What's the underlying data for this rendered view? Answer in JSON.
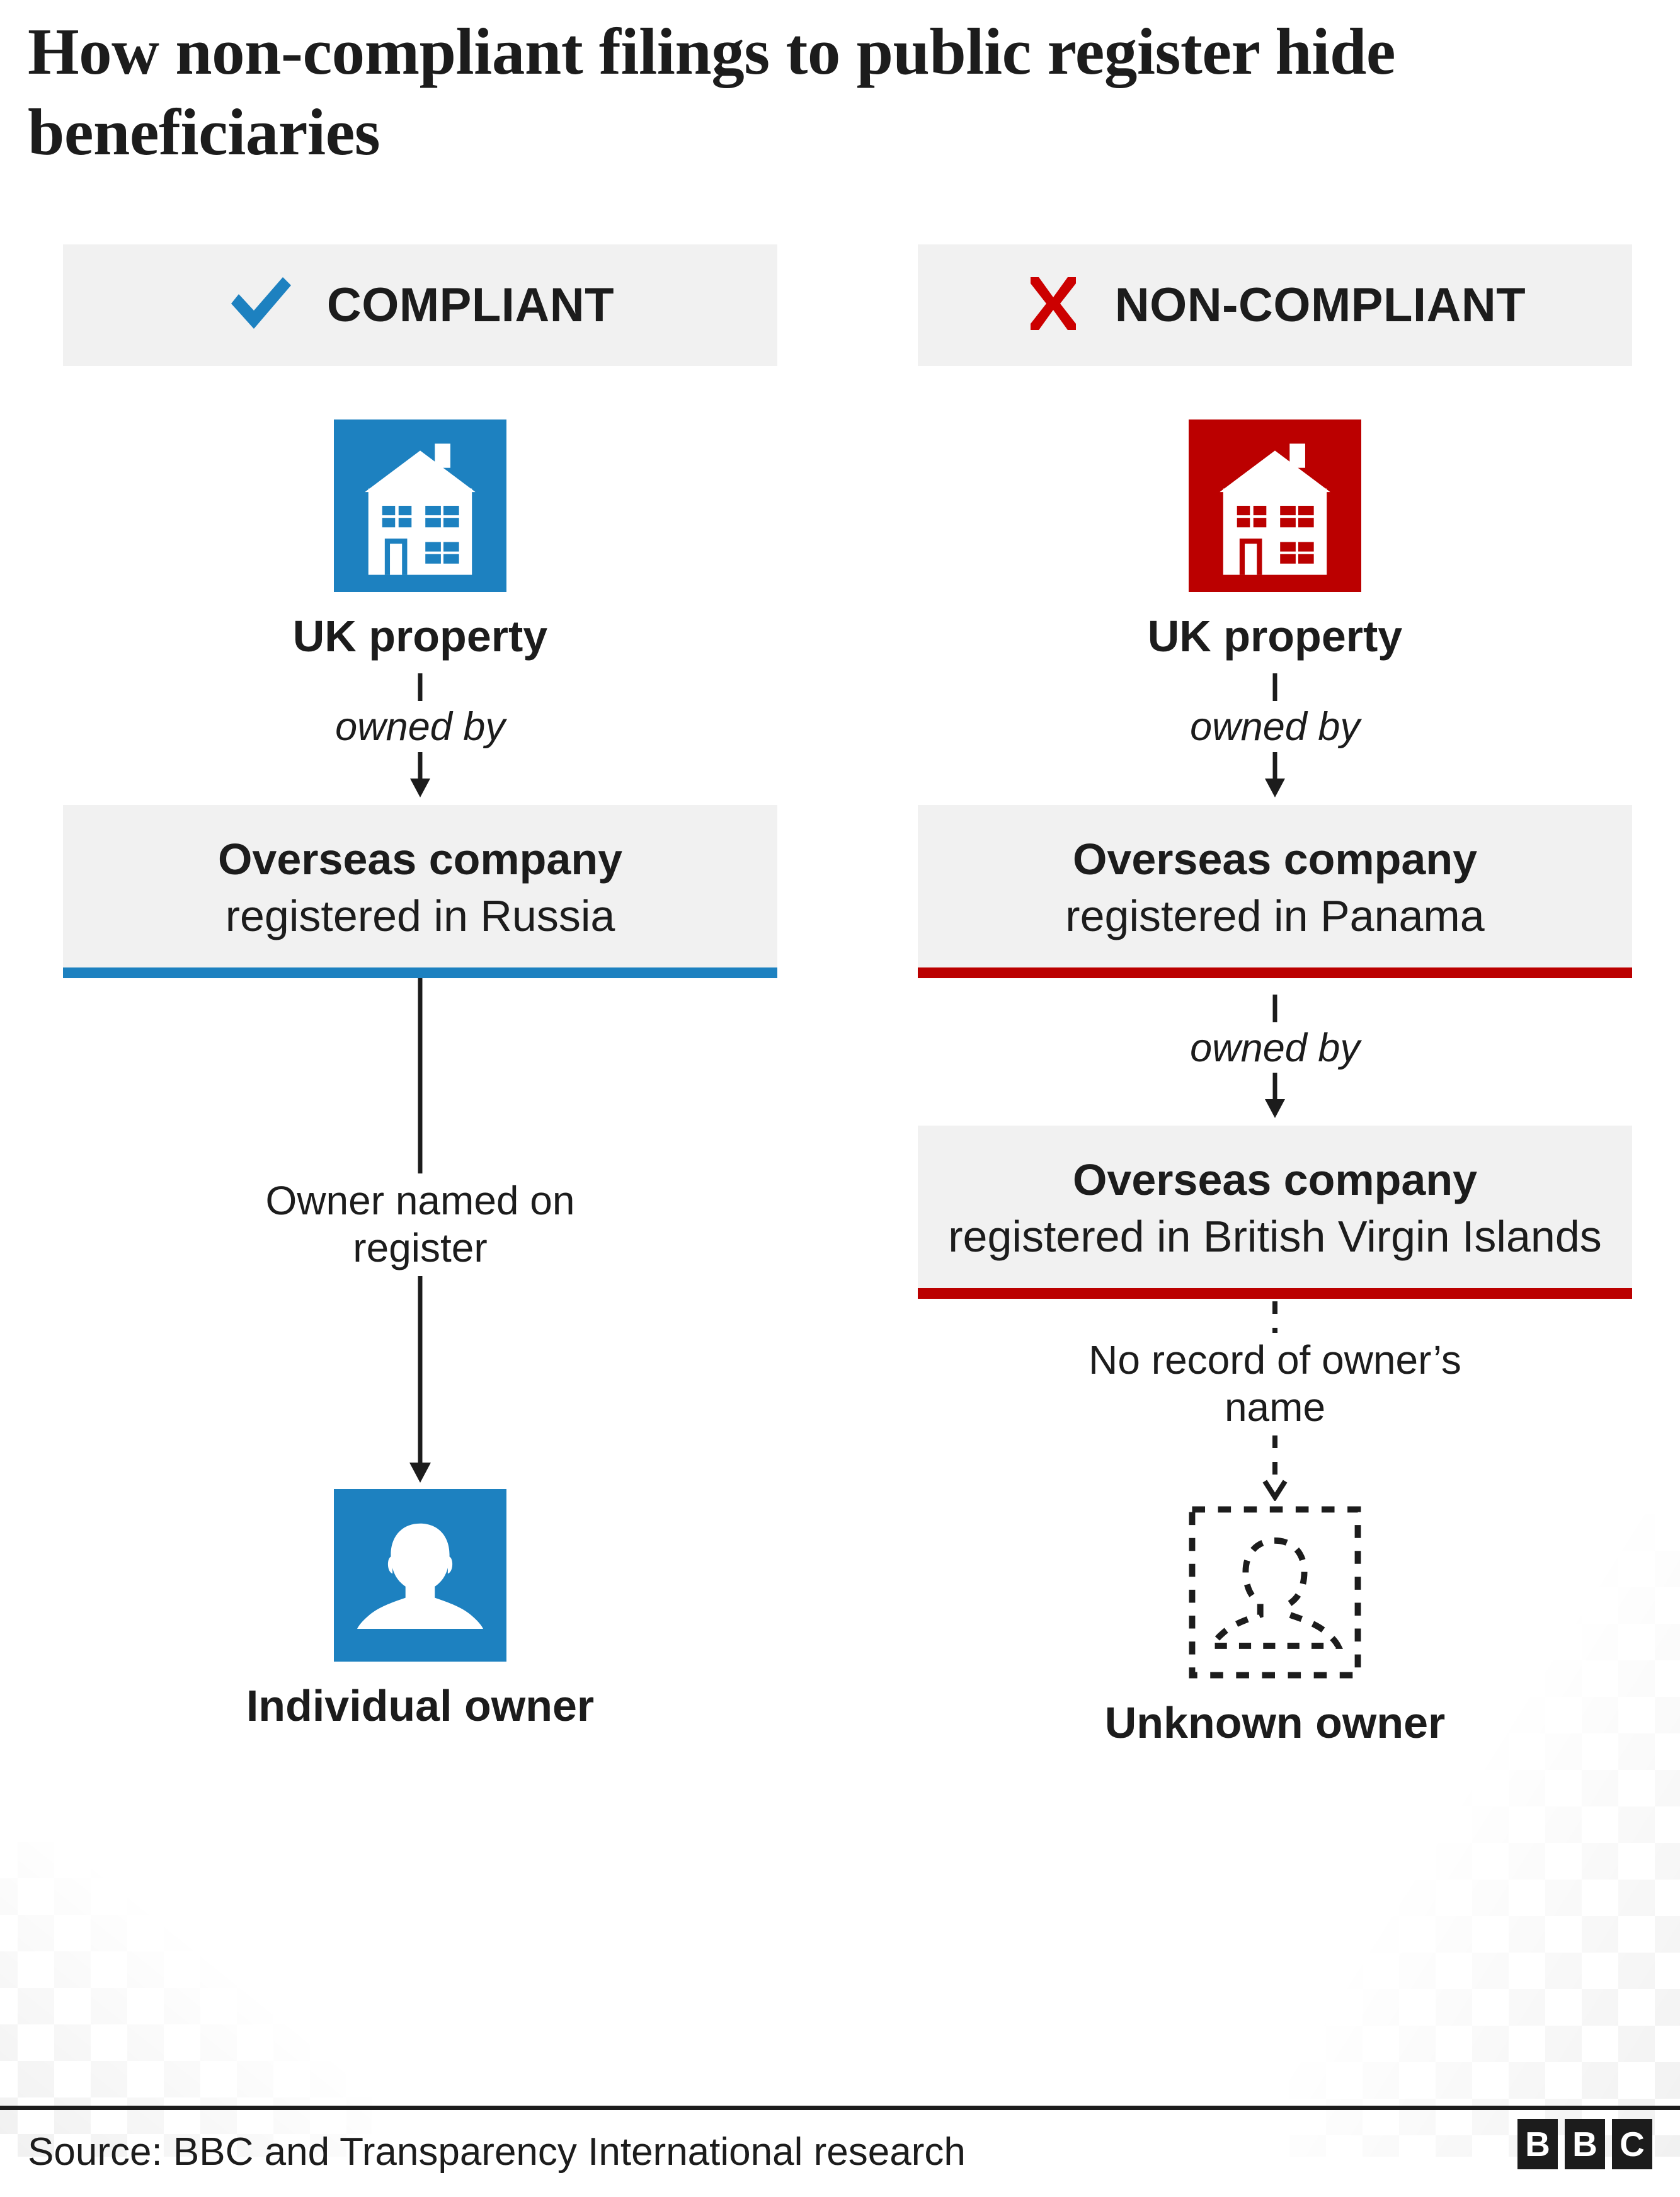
{
  "headline": "How non-compliant filings to public register hide beneficiaries",
  "colors": {
    "blue": "#1d81c0",
    "red": "#bb0000",
    "box_bg": "#f1f1f1",
    "text": "#1c1c1c",
    "page_bg": "#ffffff"
  },
  "columns": [
    {
      "id": "compliant",
      "badge": {
        "label": "COMPLIANT",
        "icon": "check-icon",
        "icon_color": "#1d81c0"
      },
      "property": {
        "icon": "house-icon",
        "tile_color": "#1d81c0",
        "label": "UK property"
      },
      "connector_1": {
        "caption": "owned by",
        "style": "italic",
        "line": "solid",
        "arrowhead": "filled"
      },
      "company_1": {
        "title": "Overseas company",
        "subtitle": "registered in Russia",
        "rule_color": "#1d81c0"
      },
      "connector_2": {
        "caption": "Owner named on register",
        "style": "plain",
        "line": "solid",
        "arrowhead": "filled"
      },
      "owner": {
        "icon": "person-icon",
        "tile_color": "#1d81c0",
        "style": "solid",
        "label": "Individual owner"
      }
    },
    {
      "id": "non-compliant",
      "badge": {
        "label": "NON-COMPLIANT",
        "icon": "cross-icon",
        "icon_color": "#cc0000"
      },
      "property": {
        "icon": "house-icon",
        "tile_color": "#bb0000",
        "label": "UK property"
      },
      "connector_1": {
        "caption": "owned by",
        "style": "italic",
        "line": "solid",
        "arrowhead": "filled"
      },
      "company_1": {
        "title": "Overseas company",
        "subtitle": "registered in Panama",
        "rule_color": "#bb0000"
      },
      "connector_2": {
        "caption": "owned by",
        "style": "italic",
        "line": "solid",
        "arrowhead": "filled"
      },
      "company_2": {
        "title": "Overseas company",
        "subtitle": "registered in British Virgin Islands",
        "rule_color": "#bb0000"
      },
      "connector_3": {
        "caption": "No record of owner’s name",
        "style": "plain",
        "line": "dashed",
        "arrowhead": "open"
      },
      "owner": {
        "icon": "unknown-person-icon",
        "tile_color": "transparent",
        "style": "dashed",
        "label": "Unknown owner"
      }
    }
  ],
  "footer": {
    "source": "Source: BBC and Transparency International research",
    "logo": [
      "B",
      "B",
      "C"
    ]
  }
}
